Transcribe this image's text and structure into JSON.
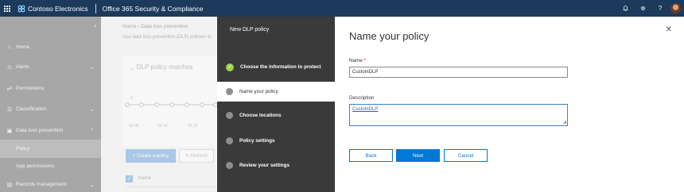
{
  "topbar": {
    "brand_name": "Contoso Electronics",
    "suite_title": "Office 365 Security & Compliance",
    "icons": [
      "bell-icon",
      "gear-icon",
      "help-icon"
    ],
    "help_label": "?"
  },
  "leftnav": {
    "items": [
      {
        "label": "Home",
        "icon": "home-icon"
      },
      {
        "label": "Alerts",
        "icon": "alert-icon"
      },
      {
        "label": "Permissions",
        "icon": "permissions-icon"
      },
      {
        "label": "Classification",
        "icon": "classification-icon"
      },
      {
        "label": "Data loss prevention",
        "icon": "dlp-icon"
      },
      {
        "label": "Policy"
      },
      {
        "label": "App permissions"
      },
      {
        "label": "Records management",
        "icon": "records-icon"
      }
    ]
  },
  "background": {
    "breadcrumb": "Home  ›  Data loss prevention",
    "subtitle": "Use data loss prevention (DLP) policies to",
    "card_title": "DLP policy matches",
    "chart_y_label": "0",
    "chart_x_labels": [
      "06 08",
      "06 10",
      "06 12"
    ],
    "create_button": "+ Create a policy",
    "refresh_button": "↻ Refresh",
    "list_header": "Name"
  },
  "wizard": {
    "title": "New DLP policy",
    "steps": [
      {
        "label": "Choose the information to protect",
        "state": "done"
      },
      {
        "label": "Name your policy",
        "state": "current"
      },
      {
        "label": "Choose locations",
        "state": "pending"
      },
      {
        "label": "Policy settings",
        "state": "pending"
      },
      {
        "label": "Review your settings",
        "state": "pending"
      }
    ]
  },
  "form": {
    "title": "Name your policy",
    "name_label": "Name",
    "required_marker": "*",
    "name_value": "CustomDLP",
    "description_label": "Description",
    "description_value": "CustomDLP",
    "back_button": "Back",
    "next_button": "Next",
    "cancel_button": "Cancel"
  },
  "colors": {
    "topbar": "#1b3a5c",
    "primary": "#0078d4",
    "step_done": "#9bd34c",
    "wizard_bg": "#3a3a3a"
  }
}
